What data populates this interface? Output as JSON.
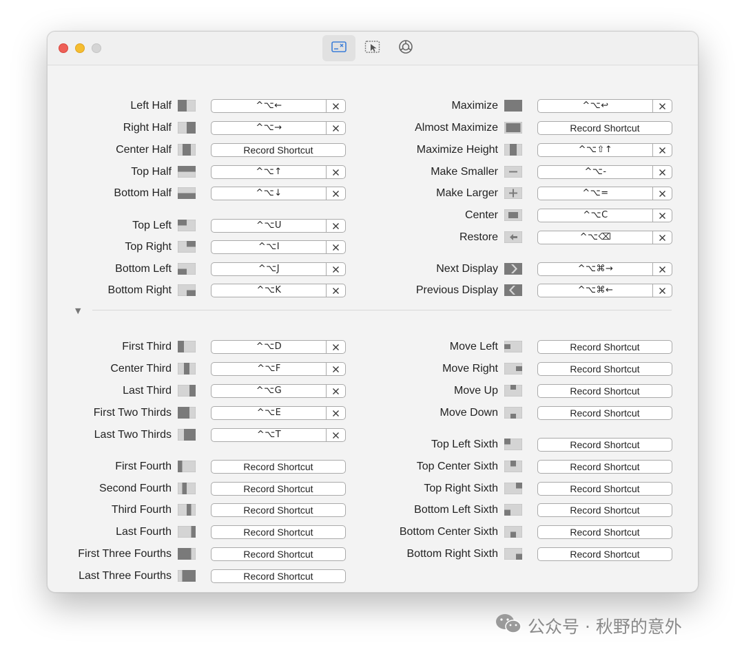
{
  "toolbar": {
    "tabs": [
      {
        "icon": "window-snapping-icon"
      },
      {
        "icon": "cursor-window-icon"
      },
      {
        "icon": "settings-gear-icon"
      }
    ]
  },
  "left_col": [
    {
      "label": "Left Half",
      "shortcut": "^⌥←",
      "icon": "left-half-icon"
    },
    {
      "label": "Right Half",
      "shortcut": "^⌥→",
      "icon": "right-half-icon"
    },
    {
      "label": "Center Half",
      "shortcut": "Record Shortcut",
      "icon": "center-half-icon"
    },
    {
      "label": "Top Half",
      "shortcut": "^⌥↑",
      "icon": "top-half-icon"
    },
    {
      "label": "Bottom Half",
      "shortcut": "^⌥↓",
      "icon": "bottom-half-icon"
    },
    {
      "label": "Top Left",
      "shortcut": "^⌥U",
      "icon": "top-left-icon"
    },
    {
      "label": "Top Right",
      "shortcut": "^⌥I",
      "icon": "top-right-icon"
    },
    {
      "label": "Bottom Left",
      "shortcut": "^⌥J",
      "icon": "bottom-left-icon"
    },
    {
      "label": "Bottom Right",
      "shortcut": "^⌥K",
      "icon": "bottom-right-icon"
    },
    {
      "label": "First Third",
      "shortcut": "^⌥D",
      "icon": "first-third-icon"
    },
    {
      "label": "Center Third",
      "shortcut": "^⌥F",
      "icon": "center-third-icon"
    },
    {
      "label": "Last Third",
      "shortcut": "^⌥G",
      "icon": "last-third-icon"
    },
    {
      "label": "First Two Thirds",
      "shortcut": "^⌥E",
      "icon": "first-two-thirds-icon"
    },
    {
      "label": "Last Two Thirds",
      "shortcut": "^⌥T",
      "icon": "last-two-thirds-icon"
    },
    {
      "label": "First Fourth",
      "shortcut": "Record Shortcut",
      "icon": "first-fourth-icon"
    },
    {
      "label": "Second Fourth",
      "shortcut": "Record Shortcut",
      "icon": "second-fourth-icon"
    },
    {
      "label": "Third Fourth",
      "shortcut": "Record Shortcut",
      "icon": "third-fourth-icon"
    },
    {
      "label": "Last Fourth",
      "shortcut": "Record Shortcut",
      "icon": "last-fourth-icon"
    },
    {
      "label": "First Three Fourths",
      "shortcut": "Record Shortcut",
      "icon": "first-three-fourths-icon"
    },
    {
      "label": "Last Three Fourths",
      "shortcut": "Record Shortcut",
      "icon": "last-three-fourths-icon"
    }
  ],
  "right_col": [
    {
      "label": "Maximize",
      "shortcut": "^⌥↩",
      "icon": "maximize-icon"
    },
    {
      "label": "Almost Maximize",
      "shortcut": "Record Shortcut",
      "icon": "almost-maximize-icon"
    },
    {
      "label": "Maximize Height",
      "shortcut": "^⌥⇧↑",
      "icon": "maximize-height-icon"
    },
    {
      "label": "Make Smaller",
      "shortcut": "^⌥-",
      "icon": "make-smaller-icon"
    },
    {
      "label": "Make Larger",
      "shortcut": "^⌥=",
      "icon": "make-larger-icon"
    },
    {
      "label": "Center",
      "shortcut": "^⌥C",
      "icon": "center-icon"
    },
    {
      "label": "Restore",
      "shortcut": "^⌥⌫",
      "icon": "restore-icon"
    },
    {
      "label": "Next Display",
      "shortcut": "^⌥⌘→",
      "icon": "next-display-icon"
    },
    {
      "label": "Previous Display",
      "shortcut": "^⌥⌘←",
      "icon": "previous-display-icon"
    },
    {
      "label": "Move Left",
      "shortcut": "Record Shortcut",
      "icon": "move-left-icon"
    },
    {
      "label": "Move Right",
      "shortcut": "Record Shortcut",
      "icon": "move-right-icon"
    },
    {
      "label": "Move Up",
      "shortcut": "Record Shortcut",
      "icon": "move-up-icon"
    },
    {
      "label": "Move Down",
      "shortcut": "Record Shortcut",
      "icon": "move-down-icon"
    },
    {
      "label": "Top Left Sixth",
      "shortcut": "Record Shortcut",
      "icon": "top-left-sixth-icon"
    },
    {
      "label": "Top Center Sixth",
      "shortcut": "Record Shortcut",
      "icon": "top-center-sixth-icon"
    },
    {
      "label": "Top Right Sixth",
      "shortcut": "Record Shortcut",
      "icon": "top-right-sixth-icon"
    },
    {
      "label": "Bottom Left Sixth",
      "shortcut": "Record Shortcut",
      "icon": "bottom-left-sixth-icon"
    },
    {
      "label": "Bottom Center Sixth",
      "shortcut": "Record Shortcut",
      "icon": "bottom-center-sixth-icon"
    },
    {
      "label": "Bottom Right Sixth",
      "shortcut": "Record Shortcut",
      "icon": "bottom-right-sixth-icon"
    }
  ],
  "watermark": "公众号 · 秋野的意外",
  "colors": {
    "icon_fill": "#7a7a7a",
    "icon_bg": "#d4d4d4",
    "close": "#ee5f57",
    "minimize": "#f5bd30"
  }
}
